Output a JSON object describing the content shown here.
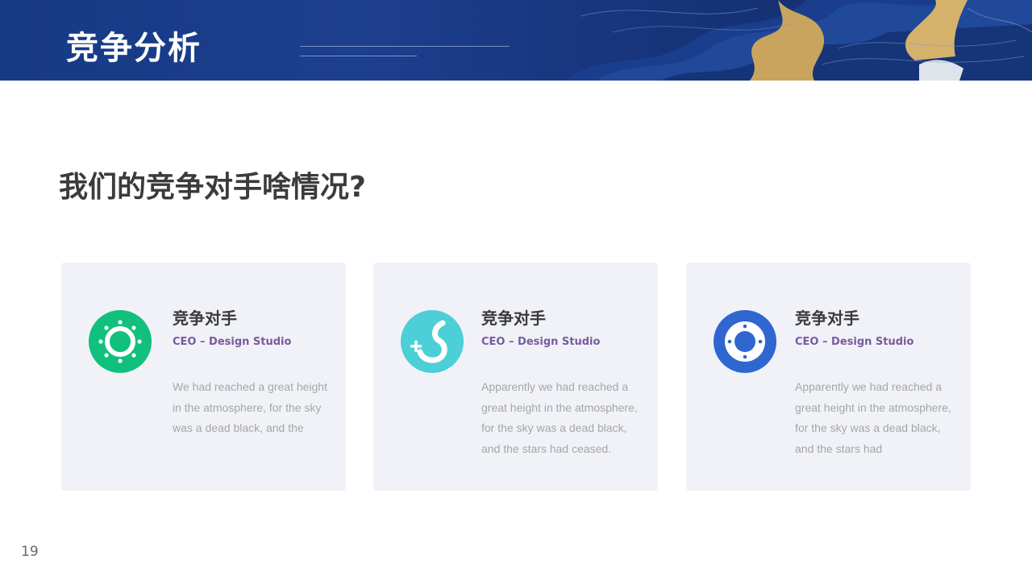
{
  "header": {
    "title": "竞争分析"
  },
  "page_heading": "我们的竞争对手啥情况?",
  "cards": [
    {
      "title": "竞争对手",
      "subtitle": "CEO – Design  Studio",
      "body": "We had reached a great height in the atmosphere, for the sky was  a dead black, and the",
      "icon": "sun-icon",
      "icon_color": "#11c07d"
    },
    {
      "title": "竞争对手",
      "subtitle": "CEO – Design  Studio",
      "body": "Apparently we  had reached a great height in the atmosphere, for the sky was  a dead black, and the stars had ceased.",
      "icon": "plus-swoosh-icon",
      "icon_color": "#4ccfd7"
    },
    {
      "title": "竞争对手",
      "subtitle": "CEO – Design  Studio",
      "body": "Apparently we  had reached a great height in the atmosphere, for the sky was  a dead black, and the stars had",
      "icon": "target-icon",
      "icon_color": "#2f66d0"
    }
  ],
  "page_number": "19",
  "colors": {
    "header_bg": "#1c3f8e",
    "gold_accent": "#c9a45e",
    "card_bg": "#f0f2f8",
    "subtitle": "#7a5a9c",
    "body_text": "#a6a6a6"
  }
}
